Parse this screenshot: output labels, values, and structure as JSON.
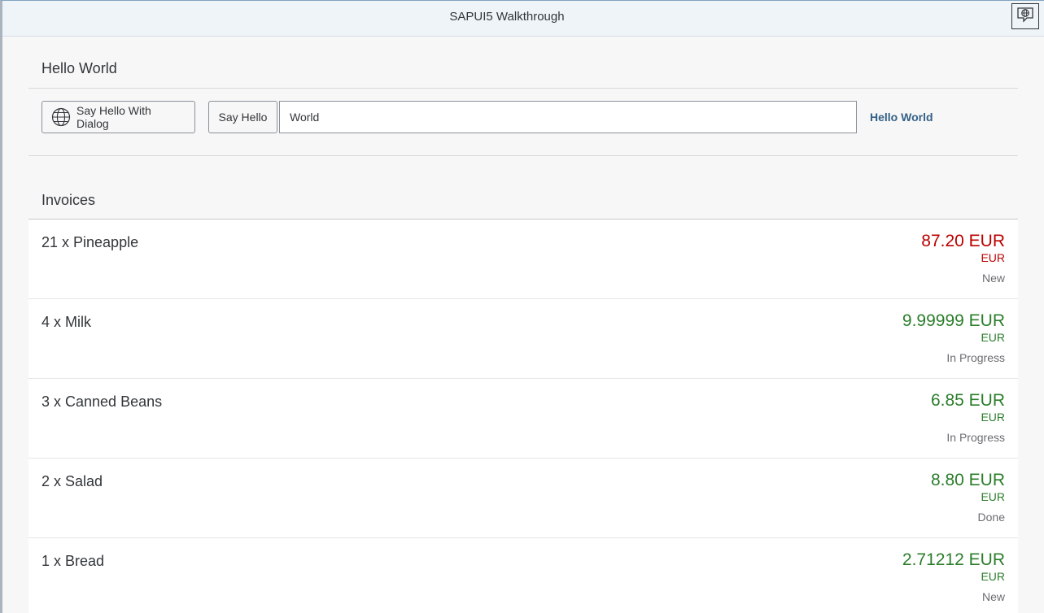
{
  "shell": {
    "title": "SAPUI5 Walkthrough",
    "help_icon": "globe-help-icon"
  },
  "hello_panel": {
    "header": "Hello World",
    "dialog_button_label": "Say Hello With Dialog",
    "dialog_button_icon": "globe-icon",
    "say_hello_label": "Say Hello",
    "input_value": "World",
    "greeting_text": "Hello World"
  },
  "invoices": {
    "title": "Invoices",
    "items": [
      {
        "title": "21 x Pineapple",
        "number": "87.20 EUR",
        "unit": "EUR",
        "status": "New",
        "state": "error"
      },
      {
        "title": "4 x Milk",
        "number": "9.99999 EUR",
        "unit": "EUR",
        "status": "In Progress",
        "state": "success"
      },
      {
        "title": "3 x Canned Beans",
        "number": "6.85 EUR",
        "unit": "EUR",
        "status": "In Progress",
        "state": "success"
      },
      {
        "title": "2 x Salad",
        "number": "8.80 EUR",
        "unit": "EUR",
        "status": "Done",
        "state": "success"
      },
      {
        "title": "1 x Bread",
        "number": "2.71212 EUR",
        "unit": "EUR",
        "status": "New",
        "state": "success"
      }
    ]
  },
  "colors": {
    "error": "#bb0000",
    "success": "#2b7d2b",
    "link": "#346187",
    "shell_bg": "#eff4f9"
  }
}
